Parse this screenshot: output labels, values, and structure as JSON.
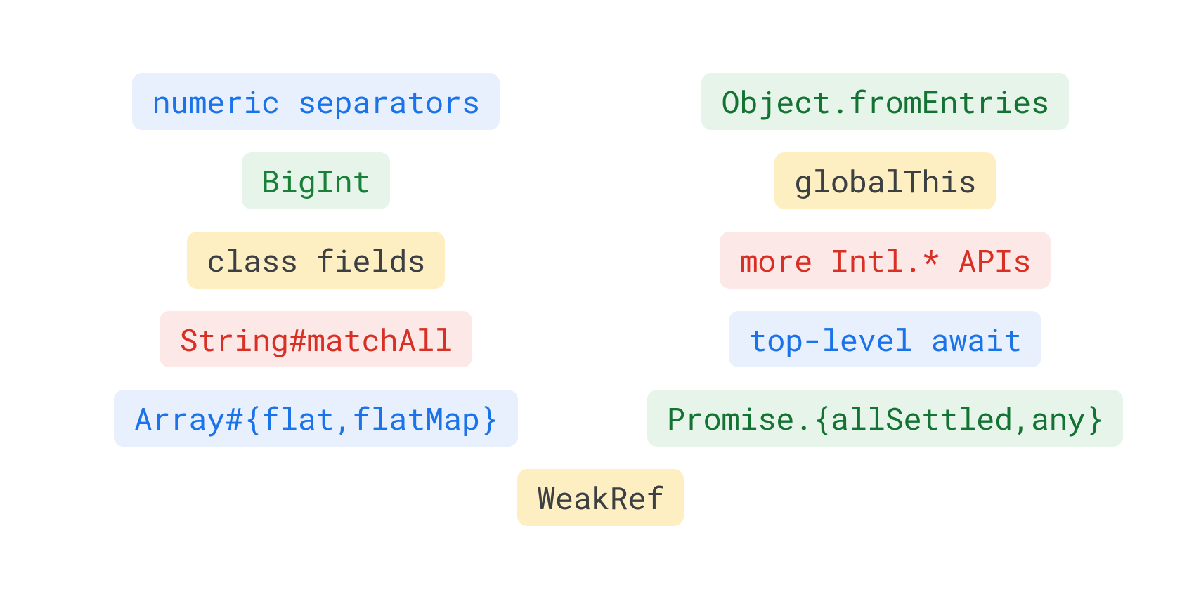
{
  "colors": {
    "blue_bg": "#e8f0fe",
    "blue_text": "#1a73e8",
    "green_bg": "#e6f4ea",
    "green_text": "#188038",
    "yellow_bg": "#feefc3",
    "yellow_text": "#3c4043",
    "red_bg": "#fce8e6",
    "red_text": "#d93025"
  },
  "left": [
    {
      "label": "numeric separators",
      "theme": "blue"
    },
    {
      "label": "BigInt",
      "theme": "green-text"
    },
    {
      "label": "class fields",
      "theme": "yellow"
    },
    {
      "label": "String#matchAll",
      "theme": "red"
    },
    {
      "label": "Array#{flat,flatMap}",
      "theme": "blue"
    }
  ],
  "right": [
    {
      "label": "Object.fromEntries",
      "theme": "green-dark"
    },
    {
      "label": "globalThis",
      "theme": "yellow"
    },
    {
      "label": "more Intl.* APIs",
      "theme": "red"
    },
    {
      "label": "top-level await",
      "theme": "blue"
    },
    {
      "label": "Promise.{allSettled,any}",
      "theme": "green-dark"
    }
  ],
  "footer": {
    "label": "WeakRef",
    "theme": "yellow"
  }
}
